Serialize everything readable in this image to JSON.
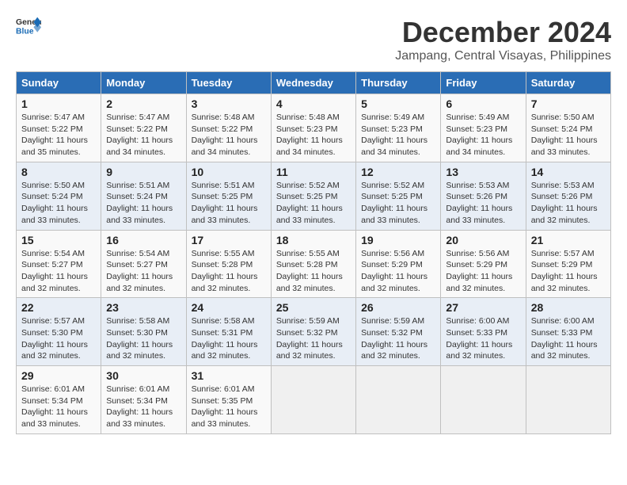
{
  "logo": {
    "line1": "General",
    "line2": "Blue"
  },
  "title": "December 2024",
  "location": "Jampang, Central Visayas, Philippines",
  "weekdays": [
    "Sunday",
    "Monday",
    "Tuesday",
    "Wednesday",
    "Thursday",
    "Friday",
    "Saturday"
  ],
  "weeks": [
    [
      {
        "day": "1",
        "info": "Sunrise: 5:47 AM\nSunset: 5:22 PM\nDaylight: 11 hours and 35 minutes."
      },
      {
        "day": "2",
        "info": "Sunrise: 5:47 AM\nSunset: 5:22 PM\nDaylight: 11 hours and 34 minutes."
      },
      {
        "day": "3",
        "info": "Sunrise: 5:48 AM\nSunset: 5:22 PM\nDaylight: 11 hours and 34 minutes."
      },
      {
        "day": "4",
        "info": "Sunrise: 5:48 AM\nSunset: 5:23 PM\nDaylight: 11 hours and 34 minutes."
      },
      {
        "day": "5",
        "info": "Sunrise: 5:49 AM\nSunset: 5:23 PM\nDaylight: 11 hours and 34 minutes."
      },
      {
        "day": "6",
        "info": "Sunrise: 5:49 AM\nSunset: 5:23 PM\nDaylight: 11 hours and 34 minutes."
      },
      {
        "day": "7",
        "info": "Sunrise: 5:50 AM\nSunset: 5:24 PM\nDaylight: 11 hours and 33 minutes."
      }
    ],
    [
      {
        "day": "8",
        "info": "Sunrise: 5:50 AM\nSunset: 5:24 PM\nDaylight: 11 hours and 33 minutes."
      },
      {
        "day": "9",
        "info": "Sunrise: 5:51 AM\nSunset: 5:24 PM\nDaylight: 11 hours and 33 minutes."
      },
      {
        "day": "10",
        "info": "Sunrise: 5:51 AM\nSunset: 5:25 PM\nDaylight: 11 hours and 33 minutes."
      },
      {
        "day": "11",
        "info": "Sunrise: 5:52 AM\nSunset: 5:25 PM\nDaylight: 11 hours and 33 minutes."
      },
      {
        "day": "12",
        "info": "Sunrise: 5:52 AM\nSunset: 5:25 PM\nDaylight: 11 hours and 33 minutes."
      },
      {
        "day": "13",
        "info": "Sunrise: 5:53 AM\nSunset: 5:26 PM\nDaylight: 11 hours and 33 minutes."
      },
      {
        "day": "14",
        "info": "Sunrise: 5:53 AM\nSunset: 5:26 PM\nDaylight: 11 hours and 32 minutes."
      }
    ],
    [
      {
        "day": "15",
        "info": "Sunrise: 5:54 AM\nSunset: 5:27 PM\nDaylight: 11 hours and 32 minutes."
      },
      {
        "day": "16",
        "info": "Sunrise: 5:54 AM\nSunset: 5:27 PM\nDaylight: 11 hours and 32 minutes."
      },
      {
        "day": "17",
        "info": "Sunrise: 5:55 AM\nSunset: 5:28 PM\nDaylight: 11 hours and 32 minutes."
      },
      {
        "day": "18",
        "info": "Sunrise: 5:55 AM\nSunset: 5:28 PM\nDaylight: 11 hours and 32 minutes."
      },
      {
        "day": "19",
        "info": "Sunrise: 5:56 AM\nSunset: 5:29 PM\nDaylight: 11 hours and 32 minutes."
      },
      {
        "day": "20",
        "info": "Sunrise: 5:56 AM\nSunset: 5:29 PM\nDaylight: 11 hours and 32 minutes."
      },
      {
        "day": "21",
        "info": "Sunrise: 5:57 AM\nSunset: 5:29 PM\nDaylight: 11 hours and 32 minutes."
      }
    ],
    [
      {
        "day": "22",
        "info": "Sunrise: 5:57 AM\nSunset: 5:30 PM\nDaylight: 11 hours and 32 minutes."
      },
      {
        "day": "23",
        "info": "Sunrise: 5:58 AM\nSunset: 5:30 PM\nDaylight: 11 hours and 32 minutes."
      },
      {
        "day": "24",
        "info": "Sunrise: 5:58 AM\nSunset: 5:31 PM\nDaylight: 11 hours and 32 minutes."
      },
      {
        "day": "25",
        "info": "Sunrise: 5:59 AM\nSunset: 5:32 PM\nDaylight: 11 hours and 32 minutes."
      },
      {
        "day": "26",
        "info": "Sunrise: 5:59 AM\nSunset: 5:32 PM\nDaylight: 11 hours and 32 minutes."
      },
      {
        "day": "27",
        "info": "Sunrise: 6:00 AM\nSunset: 5:33 PM\nDaylight: 11 hours and 32 minutes."
      },
      {
        "day": "28",
        "info": "Sunrise: 6:00 AM\nSunset: 5:33 PM\nDaylight: 11 hours and 32 minutes."
      }
    ],
    [
      {
        "day": "29",
        "info": "Sunrise: 6:01 AM\nSunset: 5:34 PM\nDaylight: 11 hours and 33 minutes."
      },
      {
        "day": "30",
        "info": "Sunrise: 6:01 AM\nSunset: 5:34 PM\nDaylight: 11 hours and 33 minutes."
      },
      {
        "day": "31",
        "info": "Sunrise: 6:01 AM\nSunset: 5:35 PM\nDaylight: 11 hours and 33 minutes."
      },
      null,
      null,
      null,
      null
    ]
  ]
}
